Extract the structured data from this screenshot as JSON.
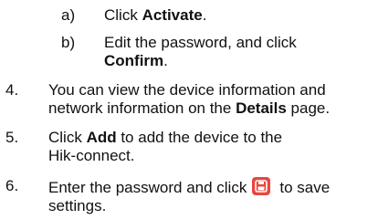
{
  "steps_sub": [
    {
      "marker": "a)",
      "prefix": "Click ",
      "bold": "Activate",
      "suffix": "."
    },
    {
      "marker": "b)",
      "line1": "Edit the password, and click",
      "line2_bold": "Confirm",
      "line2_suffix": "."
    }
  ],
  "steps_main": [
    {
      "marker": "4.",
      "line1": "You can view the device information and",
      "line2_prefix": "network information on the ",
      "line2_bold": "Details",
      "line2_suffix": " page."
    },
    {
      "marker": "5.",
      "line1_prefix": "Click ",
      "line1_bold": "Add",
      "line1_suffix": " to add the device to the",
      "line2": "Hik-connect."
    },
    {
      "marker": "6.",
      "line1_prefix": "Enter the password and click",
      "line1_suffix": "to save",
      "line2": "settings.",
      "icon": "save-icon",
      "icon_color": "#e8473e"
    }
  ]
}
